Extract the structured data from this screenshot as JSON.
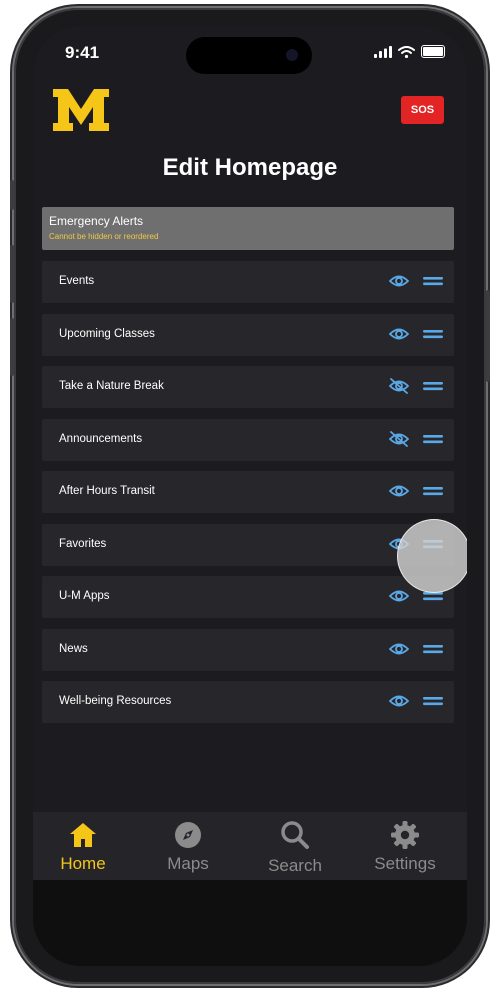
{
  "status_bar": {
    "time": "9:41"
  },
  "header": {
    "logo_text": "M",
    "sos_label": "SOS",
    "title": "Edit Homepage"
  },
  "alert": {
    "title": "Emergency Alerts",
    "subtitle": "Cannot be hidden or reordered"
  },
  "items": [
    {
      "label": "Events",
      "visible": true
    },
    {
      "label": "Upcoming Classes",
      "visible": true
    },
    {
      "label": "Take a Nature Break",
      "visible": false
    },
    {
      "label": "Announcements",
      "visible": false
    },
    {
      "label": "After Hours Transit",
      "visible": true
    },
    {
      "label": "Favorites",
      "visible": true
    },
    {
      "label": "U-M Apps",
      "visible": true
    },
    {
      "label": "News",
      "visible": true
    },
    {
      "label": "Well-being Resources",
      "visible": true
    }
  ],
  "tabs": [
    {
      "label": "Home",
      "icon": "home-icon",
      "active": true
    },
    {
      "label": "Maps",
      "icon": "compass-icon",
      "active": false
    },
    {
      "label": "Search",
      "icon": "search-icon",
      "active": false
    },
    {
      "label": "Settings",
      "icon": "gear-icon",
      "active": false
    }
  ],
  "colors": {
    "accent": "#f5c518",
    "icon_blue": "#5aa9e6",
    "sos_red": "#e32424",
    "alert_text": "#f0c945"
  }
}
